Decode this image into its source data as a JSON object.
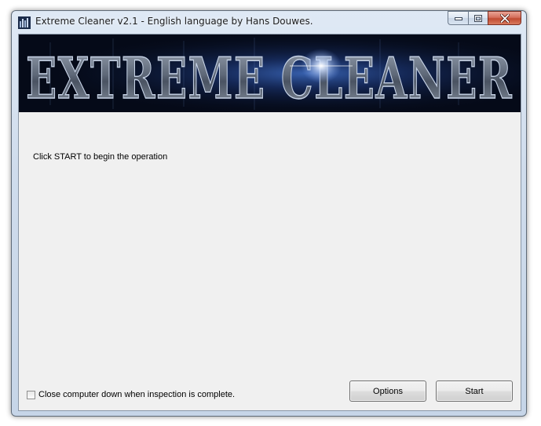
{
  "window": {
    "title": "Extreme Cleaner v2.1 - English language by Hans Douwes."
  },
  "icons": {
    "app": "app-icon",
    "minimize": "minimize-icon",
    "maximize": "maximize-icon",
    "close": "close-icon"
  },
  "banner": {
    "text": "EXTREME CLEANER"
  },
  "status": {
    "message": "Click START to begin the operation"
  },
  "shutdown_option": {
    "label": "Close computer down when inspection is complete.",
    "checked": false
  },
  "buttons": {
    "options_label": "Options",
    "start_label": "Start"
  },
  "colors": {
    "close_button": "#c8553d",
    "banner_background": "#050a18",
    "client_background": "#f0f0f0"
  }
}
